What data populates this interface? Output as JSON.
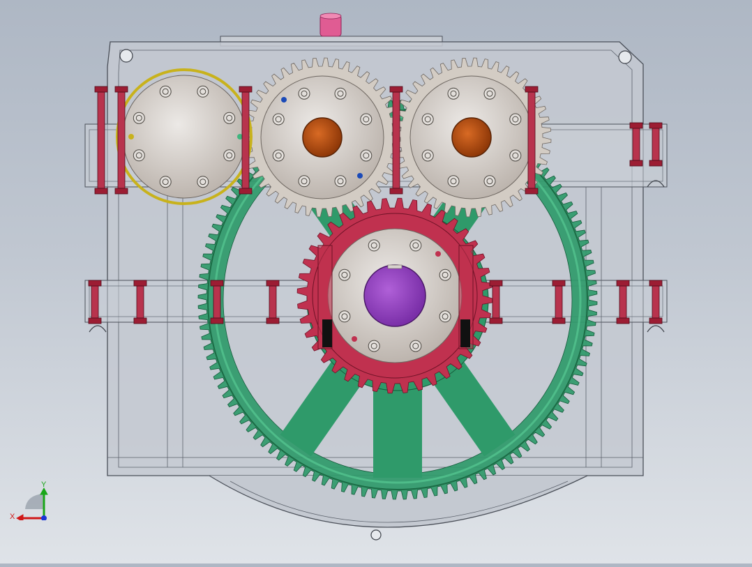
{
  "viewport": {
    "title": "",
    "colors": {
      "background_top": "#aeb7c4",
      "background_bottom": "#dfe3e8",
      "housing": "#c4c9d1",
      "housing_edge": "#4a4f58",
      "bull_gear": "#2f9a6a",
      "bull_gear_light": "#3fb57e",
      "pinion": "#c0314f",
      "idler_gear": "#d3ccc4",
      "bearing_cap": "#d8d3ce",
      "shaft_orange": "#b34a0e",
      "shaft_purple": "#8e3fb8",
      "bolt": "#9c1d33",
      "oil_plug": "#e05c93"
    },
    "components": [
      {
        "name": "housing",
        "kind": "gearbox-housing"
      },
      {
        "name": "bull-gear",
        "kind": "spur-gear",
        "color": "green"
      },
      {
        "name": "output-pinion",
        "kind": "spur-gear",
        "color": "red"
      },
      {
        "name": "left-idler",
        "kind": "spur-gear",
        "color": "beige"
      },
      {
        "name": "right-idler",
        "kind": "spur-gear",
        "color": "beige"
      },
      {
        "name": "input-cap",
        "kind": "bearing-cap"
      },
      {
        "name": "oil-plug",
        "kind": "plug"
      }
    ]
  },
  "triad": {
    "x_label": "X",
    "y_label": "Y",
    "x_color": "#d01818",
    "y_color": "#19a619",
    "z_color": "#1a36d6"
  }
}
